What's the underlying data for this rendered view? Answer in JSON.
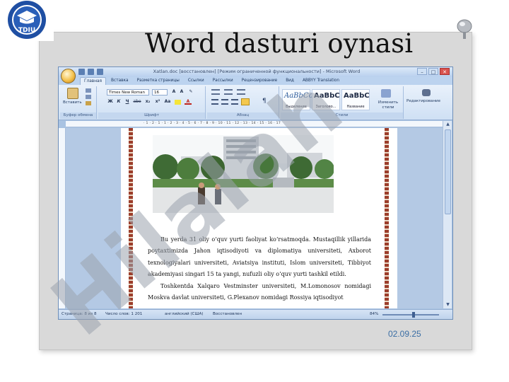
{
  "slide": {
    "title": "Word dasturi oynasi",
    "date": "02.09.25",
    "logo_text": "TDIU",
    "watermark_text": "Hilalah"
  },
  "window": {
    "title": "Xatlan.doc [восстановлен] [Режим ограниченной функциональности] - Microsoft Word",
    "controls": [
      "–",
      "□",
      "✕"
    ]
  },
  "ribbon_tabs": [
    "Главная",
    "Вставка",
    "Разметка страницы",
    "Ссылки",
    "Рассылки",
    "Рецензирование",
    "Вид",
    "ABBYY Translation"
  ],
  "ribbon": {
    "clipboard": {
      "paste": "Вставить",
      "label": "Буфер обмена"
    },
    "font": {
      "name": "Times New Roman",
      "size": "16",
      "label": "Шрифт",
      "buttons": [
        "Ж",
        "К",
        "Ч",
        "abe",
        "x₂",
        "x²",
        "Aa",
        "A"
      ]
    },
    "paragraph": {
      "label": "Абзац"
    },
    "styles": {
      "label": "Стили",
      "items": [
        {
          "sample": "AaBbCcI",
          "name": "Выделение"
        },
        {
          "sample": "AaBbC",
          "name": "Заголово..."
        },
        {
          "sample": "AaBbC",
          "name": "Название"
        }
      ],
      "change": "Изменить стили"
    },
    "editing": {
      "label": "Редактирование"
    }
  },
  "ruler_marks": "· 1 · 2 · 1 · 1 · 2 · 3 · 4 · 5 · 6 · 7 · 8 · 9 · 10 · 11 · 12 · 13 · 14 · 15 · 16 · 17",
  "document": {
    "paragraph1": "Bu yerda 31 oliy o‘quv yurti faoliyat ko‘rsatmoqda. Mustaqillik yillarida poytaxtimizda Jahon iqtisodiyoti va diplomatiya universiteti, Axborot texnologiyalari universiteti, Aviatsiya instituti, Islom universiteti, Tibbiyot akademiyasi singari 15 ta yangi, nufuzli oliy o‘quv yurti tashkil etildi.",
    "paragraph2": "Toshkentda Xalqaro Vestminster universiteti, M.Lomonosov nomidagi Moskva davlat universiteti, G.Plexanov nomidagi Rossiya iqtisodiyot"
  },
  "statusbar": {
    "page": "Страница: 8 из 8",
    "words": "Число слов: 1 201",
    "language": "английский (США)",
    "mode": "Восстановлен",
    "zoom": "84%"
  },
  "colors": {
    "word_blue": "#a9c3e2",
    "date_color": "#3b6ea5",
    "watermark": "#9aa2ad"
  }
}
